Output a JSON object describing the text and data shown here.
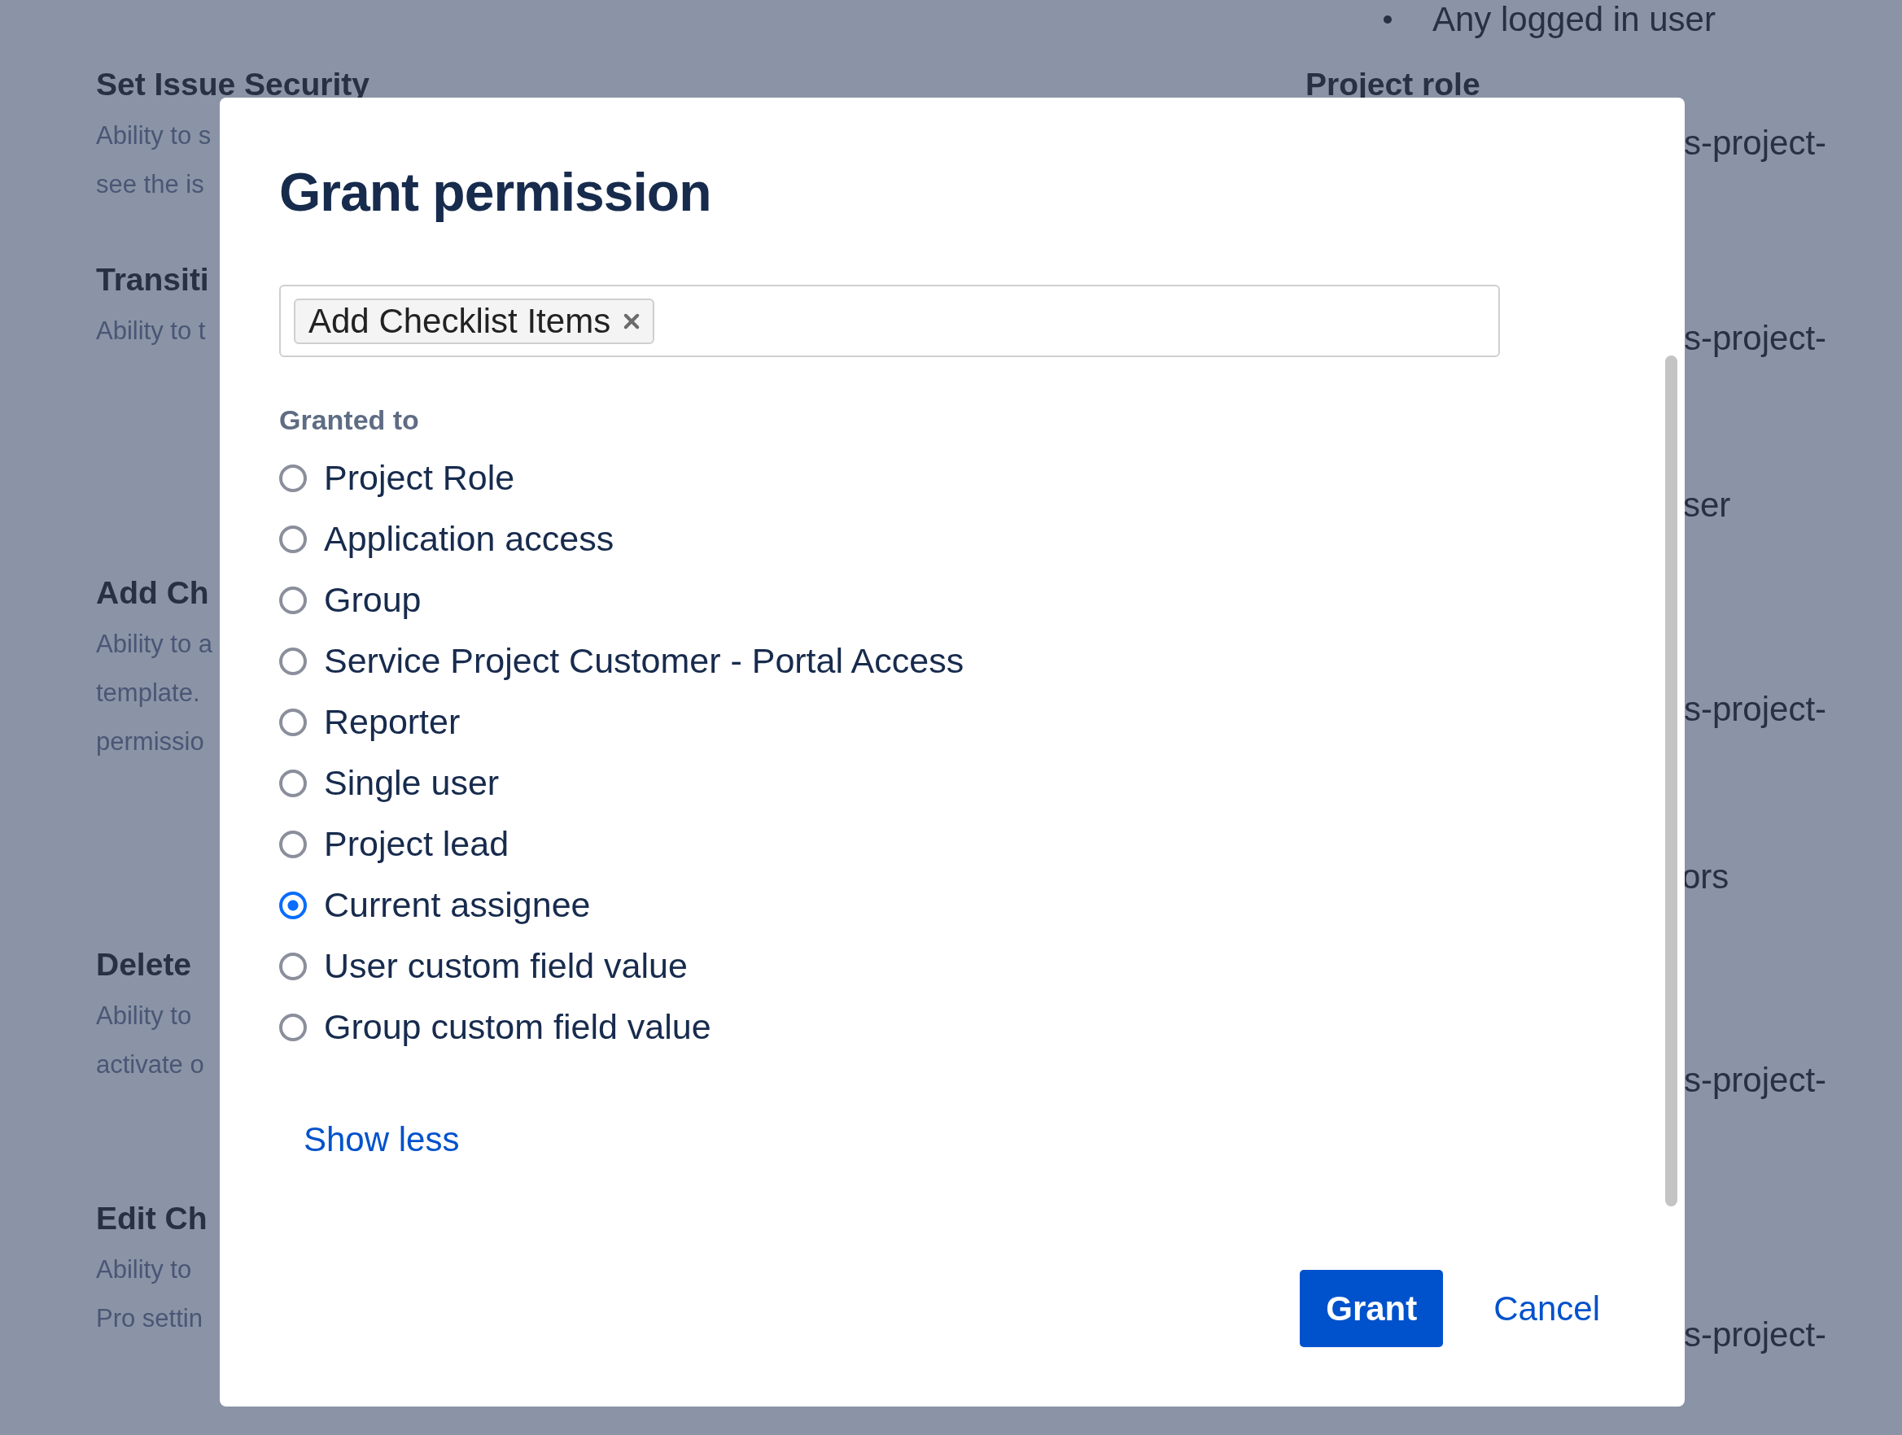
{
  "background": {
    "left_sections": [
      {
        "heading": "Set Issue Security",
        "lines": [
          "Ability to s",
          "see the is"
        ]
      },
      {
        "heading": "Transiti",
        "lines": [
          "Ability to t"
        ]
      },
      {
        "heading": "Add Ch",
        "lines": [
          "Ability to a",
          "template.",
          "permissio"
        ]
      },
      {
        "heading": "Delete",
        "lines": [
          "Ability to",
          "activate o"
        ]
      },
      {
        "heading": "Edit Ch",
        "lines": [
          "Ability to",
          "Pro settin"
        ]
      }
    ],
    "right_column": {
      "bullet_item": "Any logged in user",
      "heading": "Project role",
      "cells": [
        "s-project-",
        "s-project-",
        "ser",
        "s-project-",
        "ors",
        "s-project-",
        "s-project-"
      ]
    }
  },
  "dialog": {
    "title": "Grant permission",
    "permission_field": {
      "chips": [
        {
          "label": "Add Checklist Items"
        }
      ]
    },
    "granted_to": {
      "label": "Granted to",
      "options": [
        {
          "label": "Project Role",
          "selected": false
        },
        {
          "label": "Application access",
          "selected": false
        },
        {
          "label": "Group",
          "selected": false
        },
        {
          "label": "Service Project Customer - Portal Access",
          "selected": false
        },
        {
          "label": "Reporter",
          "selected": false
        },
        {
          "label": "Single user",
          "selected": false
        },
        {
          "label": "Project lead",
          "selected": false
        },
        {
          "label": "Current assignee",
          "selected": true
        },
        {
          "label": "User custom field value",
          "selected": false
        },
        {
          "label": "Group custom field value",
          "selected": false
        }
      ]
    },
    "show_less": "Show less",
    "buttons": [
      {
        "label": "Grant",
        "kind": "primary"
      },
      {
        "label": "Cancel",
        "kind": "link"
      }
    ]
  }
}
